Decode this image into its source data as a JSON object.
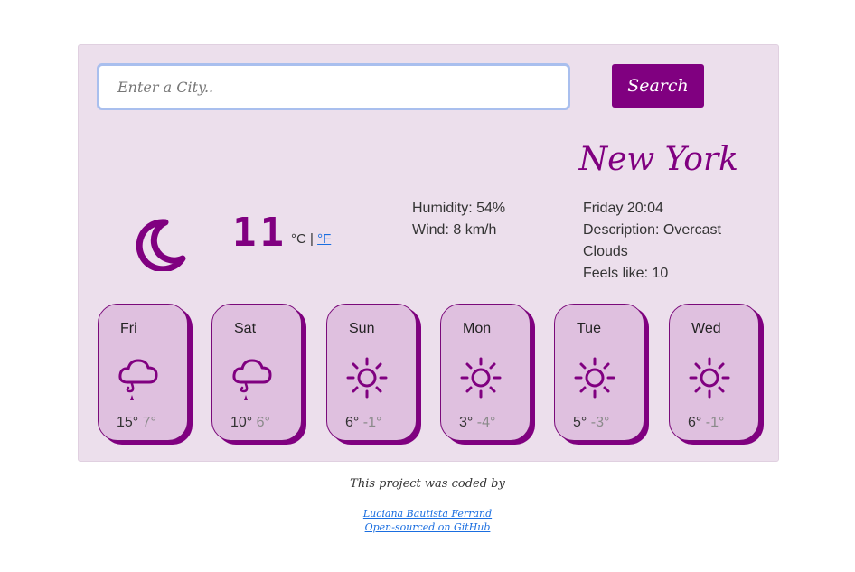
{
  "search": {
    "placeholder": "Enter a City..",
    "button_label": "Search"
  },
  "current": {
    "city": "New York",
    "temperature": "11",
    "unit_c": "°C",
    "unit_sep": " | ",
    "unit_f": "°F",
    "humidity": "Humidity: 54%",
    "wind": "Wind: 8 km/h",
    "datetime": "Friday 20:04",
    "description": "Description: Overcast Clouds",
    "feels_like": "Feels like: 10",
    "icon": "moon-icon"
  },
  "forecast": [
    {
      "day": "Fri",
      "max": "15°",
      "min": "7°",
      "icon": "rain-cloud-icon"
    },
    {
      "day": "Sat",
      "max": "10°",
      "min": "6°",
      "icon": "rain-cloud-icon"
    },
    {
      "day": "Sun",
      "max": "6°",
      "min": "-1°",
      "icon": "sun-icon"
    },
    {
      "day": "Mon",
      "max": "3°",
      "min": "-4°",
      "icon": "sun-icon"
    },
    {
      "day": "Tue",
      "max": "5°",
      "min": "-3°",
      "icon": "sun-icon"
    },
    {
      "day": "Wed",
      "max": "6°",
      "min": "-1°",
      "icon": "sun-icon"
    }
  ],
  "footer": {
    "credit": "This project was coded by",
    "author": "Luciana Bautista Ferrand",
    "source": "Open-sourced on GitHub"
  },
  "colors": {
    "accent": "#800080",
    "panel": "#ecdfec",
    "card": "#dfc0df"
  }
}
